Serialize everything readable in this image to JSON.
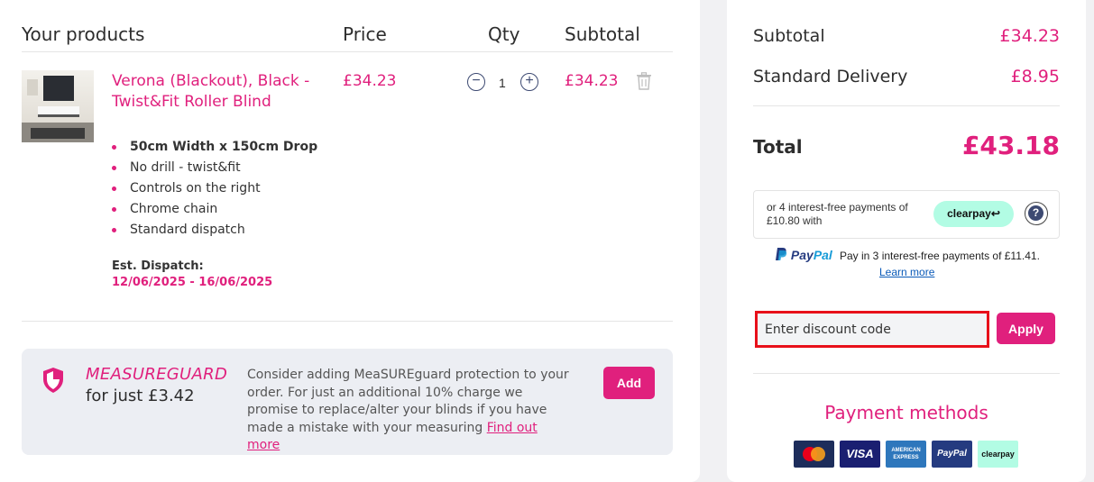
{
  "cart": {
    "headers": {
      "products": "Your products",
      "price": "Price",
      "qty": "Qty",
      "subtotal": "Subtotal"
    },
    "item": {
      "title": "Verona (Blackout), Black - Twist&Fit Roller Blind",
      "price": "£34.23",
      "qty": "1",
      "subtotal": "£34.23",
      "features": [
        "50cm Width x 150cm Drop",
        "No drill - twist&fit",
        "Controls on the right",
        "Chrome chain",
        "Standard dispatch"
      ],
      "est_dispatch_label": "Est. Dispatch:",
      "est_dispatch_dates": "12/06/2025 - 16/06/2025"
    },
    "measureguard": {
      "name": "MEASUREGUARD",
      "price_text": "for just £3.42",
      "description": "Consider adding MeaSUREguard protection to your order. For just an additional 10% charge we promise to replace/alter your blinds if you have made a mistake with your measuring ",
      "link": "Find out more",
      "add_label": "Add"
    }
  },
  "summary": {
    "subtotal_label": "Subtotal",
    "subtotal_value": "£34.23",
    "delivery_label": "Standard Delivery",
    "delivery_value": "£8.95",
    "total_label": "Total",
    "total_value": "£43.18",
    "clearpay_text": "or 4 interest-free payments of £10.80 with",
    "clearpay_badge": "clearpay↩",
    "clearpay_help": "?",
    "paypal_brand_p1": "Pay",
    "paypal_brand_p2": "Pal",
    "paypal_text": "Pay in 3 interest-free payments of £11.41.",
    "paypal_learn": "Learn more",
    "discount_placeholder": "Enter discount code",
    "apply_label": "Apply",
    "payment_methods_title": "Payment methods",
    "payment_methods": [
      "mastercard",
      "VISA",
      "AMERICAN EXPRESS",
      "PayPal",
      "clearpay"
    ]
  },
  "colors": {
    "accent": "#e0207d",
    "highlight_border": "#e8101a",
    "clearpay_mint": "#b2fce4"
  }
}
